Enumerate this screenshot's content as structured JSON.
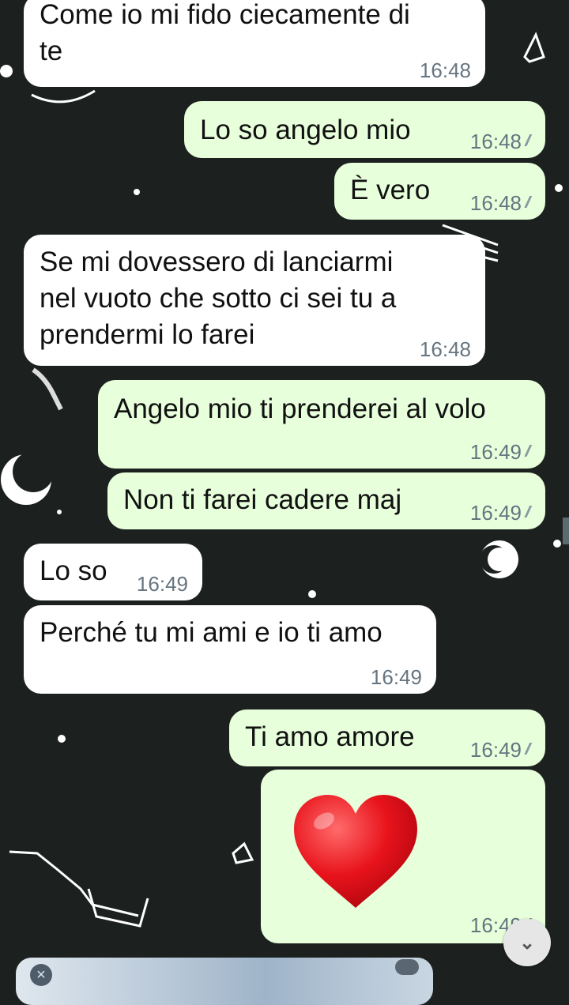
{
  "messages": [
    {
      "direction": "incoming",
      "text": "Come io mi fido ciecamente di\nte",
      "time": "16:48"
    },
    {
      "direction": "outgoing",
      "text": "Lo so angelo mio",
      "time": "16:48",
      "status": "read"
    },
    {
      "direction": "outgoing",
      "text": "È vero",
      "time": "16:48",
      "status": "read"
    },
    {
      "direction": "incoming",
      "text": "Se mi dovessero di lanciarmi\nnel vuoto che sotto ci sei tu a\nprendermi lo farei",
      "time": "16:48"
    },
    {
      "direction": "outgoing",
      "text": "Angelo mio ti prenderei al volo",
      "time": "16:49",
      "status": "read"
    },
    {
      "direction": "outgoing",
      "text": "Non ti farei cadere maj",
      "time": "16:49",
      "status": "read"
    },
    {
      "direction": "incoming",
      "text": "Lo so",
      "time": "16:49"
    },
    {
      "direction": "incoming",
      "text": "Perché tu mi ami e io ti amo",
      "time": "16:49"
    },
    {
      "direction": "outgoing",
      "text": "Ti amo amore",
      "time": "16:49",
      "status": "read"
    },
    {
      "direction": "outgoing",
      "emoji": "red-heart",
      "time": "16:49",
      "status": "read"
    }
  ],
  "icons": {
    "scroll_down": "double-chevron-down-icon",
    "reply_close": "close-icon",
    "read_receipt": "double-check-icon"
  },
  "colors": {
    "background": "#1c211f",
    "incoming_bubble": "#ffffff",
    "outgoing_bubble": "#e8ffdc",
    "timestamp": "#667580",
    "heart": "#e8131b"
  }
}
